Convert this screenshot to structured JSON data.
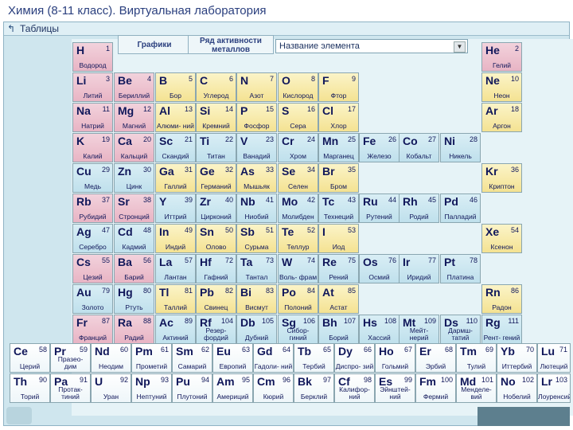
{
  "window": {
    "title": "Химия (8-11 класс). Виртуальная лаборатория"
  },
  "toolbar": {
    "icon": "back-arrow-icon",
    "label": "Таблицы"
  },
  "tabs": [
    {
      "label": "Графики"
    },
    {
      "label": "Ряд активности металлов"
    }
  ],
  "combo": {
    "value": "Название элемента"
  },
  "colors": {
    "s": "#e8b4c4",
    "p": "#f4e292",
    "d": "#bfe0ec",
    "f": "#ffffff"
  },
  "elements": [
    {
      "sym": "H",
      "num": "1",
      "name": "Водород",
      "t": "s",
      "r": 0,
      "c": 0
    },
    {
      "sym": "He",
      "num": "2",
      "name": "Гелий",
      "t": "s",
      "r": 0,
      "c": 10
    },
    {
      "sym": "Li",
      "num": "3",
      "name": "Литий",
      "t": "s",
      "r": 1,
      "c": 0
    },
    {
      "sym": "Be",
      "num": "4",
      "name": "Бериллий",
      "t": "s",
      "r": 1,
      "c": 1
    },
    {
      "sym": "B",
      "num": "5",
      "name": "Бор",
      "t": "p",
      "r": 1,
      "c": 2
    },
    {
      "sym": "C",
      "num": "6",
      "name": "Углерод",
      "t": "p",
      "r": 1,
      "c": 3
    },
    {
      "sym": "N",
      "num": "7",
      "name": "Азот",
      "t": "p",
      "r": 1,
      "c": 4
    },
    {
      "sym": "O",
      "num": "8",
      "name": "Кислород",
      "t": "p",
      "r": 1,
      "c": 5
    },
    {
      "sym": "F",
      "num": "9",
      "name": "Фтор",
      "t": "p",
      "r": 1,
      "c": 6
    },
    {
      "sym": "Ne",
      "num": "10",
      "name": "Неон",
      "t": "p",
      "r": 1,
      "c": 10
    },
    {
      "sym": "Na",
      "num": "11",
      "name": "Натрий",
      "t": "s",
      "r": 2,
      "c": 0
    },
    {
      "sym": "Mg",
      "num": "12",
      "name": "Магний",
      "t": "s",
      "r": 2,
      "c": 1
    },
    {
      "sym": "Al",
      "num": "13",
      "name": "Алюми- ний",
      "t": "p",
      "r": 2,
      "c": 2
    },
    {
      "sym": "Si",
      "num": "14",
      "name": "Кремний",
      "t": "p",
      "r": 2,
      "c": 3
    },
    {
      "sym": "P",
      "num": "15",
      "name": "Фосфор",
      "t": "p",
      "r": 2,
      "c": 4
    },
    {
      "sym": "S",
      "num": "16",
      "name": "Сера",
      "t": "p",
      "r": 2,
      "c": 5
    },
    {
      "sym": "Cl",
      "num": "17",
      "name": "Хлор",
      "t": "p",
      "r": 2,
      "c": 6
    },
    {
      "sym": "Ar",
      "num": "18",
      "name": "Аргон",
      "t": "p",
      "r": 2,
      "c": 10
    },
    {
      "sym": "K",
      "num": "19",
      "name": "Калий",
      "t": "s",
      "r": 3,
      "c": 0
    },
    {
      "sym": "Ca",
      "num": "20",
      "name": "Кальций",
      "t": "s",
      "r": 3,
      "c": 1
    },
    {
      "sym": "Sc",
      "num": "21",
      "name": "Скандий",
      "t": "d",
      "r": 3,
      "c": 2
    },
    {
      "sym": "Ti",
      "num": "22",
      "name": "Титан",
      "t": "d",
      "r": 3,
      "c": 3
    },
    {
      "sym": "V",
      "num": "23",
      "name": "Ванадий",
      "t": "d",
      "r": 3,
      "c": 4
    },
    {
      "sym": "Cr",
      "num": "24",
      "name": "Хром",
      "t": "d",
      "r": 3,
      "c": 5
    },
    {
      "sym": "Mn",
      "num": "25",
      "name": "Марганец",
      "t": "d",
      "r": 3,
      "c": 6
    },
    {
      "sym": "Fe",
      "num": "26",
      "name": "Железо",
      "t": "d",
      "r": 3,
      "c": 7
    },
    {
      "sym": "Co",
      "num": "27",
      "name": "Кобальт",
      "t": "d",
      "r": 3,
      "c": 8
    },
    {
      "sym": "Ni",
      "num": "28",
      "name": "Никель",
      "t": "d",
      "r": 3,
      "c": 9
    },
    {
      "sym": "Cu",
      "num": "29",
      "name": "Медь",
      "t": "d",
      "r": 4,
      "c": 0
    },
    {
      "sym": "Zn",
      "num": "30",
      "name": "Цинк",
      "t": "d",
      "r": 4,
      "c": 1
    },
    {
      "sym": "Ga",
      "num": "31",
      "name": "Галлий",
      "t": "p",
      "r": 4,
      "c": 2
    },
    {
      "sym": "Ge",
      "num": "32",
      "name": "Германий",
      "t": "p",
      "r": 4,
      "c": 3
    },
    {
      "sym": "As",
      "num": "33",
      "name": "Мышьяк",
      "t": "p",
      "r": 4,
      "c": 4
    },
    {
      "sym": "Se",
      "num": "34",
      "name": "Селен",
      "t": "p",
      "r": 4,
      "c": 5
    },
    {
      "sym": "Br",
      "num": "35",
      "name": "Бром",
      "t": "p",
      "r": 4,
      "c": 6
    },
    {
      "sym": "Kr",
      "num": "36",
      "name": "Криптон",
      "t": "p",
      "r": 4,
      "c": 10
    },
    {
      "sym": "Rb",
      "num": "37",
      "name": "Рубидий",
      "t": "s",
      "r": 5,
      "c": 0
    },
    {
      "sym": "Sr",
      "num": "38",
      "name": "Стронций",
      "t": "s",
      "r": 5,
      "c": 1
    },
    {
      "sym": "Y",
      "num": "39",
      "name": "Иттрий",
      "t": "d",
      "r": 5,
      "c": 2
    },
    {
      "sym": "Zr",
      "num": "40",
      "name": "Цирконий",
      "t": "d",
      "r": 5,
      "c": 3
    },
    {
      "sym": "Nb",
      "num": "41",
      "name": "Ниобий",
      "t": "d",
      "r": 5,
      "c": 4
    },
    {
      "sym": "Mo",
      "num": "42",
      "name": "Молибден",
      "t": "d",
      "r": 5,
      "c": 5
    },
    {
      "sym": "Tc",
      "num": "43",
      "name": "Технеций",
      "t": "d",
      "r": 5,
      "c": 6
    },
    {
      "sym": "Ru",
      "num": "44",
      "name": "Рутений",
      "t": "d",
      "r": 5,
      "c": 7
    },
    {
      "sym": "Rh",
      "num": "45",
      "name": "Родий",
      "t": "d",
      "r": 5,
      "c": 8
    },
    {
      "sym": "Pd",
      "num": "46",
      "name": "Палладий",
      "t": "d",
      "r": 5,
      "c": 9
    },
    {
      "sym": "Ag",
      "num": "47",
      "name": "Серебро",
      "t": "d",
      "r": 6,
      "c": 0
    },
    {
      "sym": "Cd",
      "num": "48",
      "name": "Кадмий",
      "t": "d",
      "r": 6,
      "c": 1
    },
    {
      "sym": "In",
      "num": "49",
      "name": "Индий",
      "t": "p",
      "r": 6,
      "c": 2
    },
    {
      "sym": "Sn",
      "num": "50",
      "name": "Олово",
      "t": "p",
      "r": 6,
      "c": 3
    },
    {
      "sym": "Sb",
      "num": "51",
      "name": "Сурьма",
      "t": "p",
      "r": 6,
      "c": 4
    },
    {
      "sym": "Te",
      "num": "52",
      "name": "Теллур",
      "t": "p",
      "r": 6,
      "c": 5
    },
    {
      "sym": "I",
      "num": "53",
      "name": "Иод",
      "t": "p",
      "r": 6,
      "c": 6
    },
    {
      "sym": "Xe",
      "num": "54",
      "name": "Ксенон",
      "t": "p",
      "r": 6,
      "c": 10
    },
    {
      "sym": "Cs",
      "num": "55",
      "name": "Цезий",
      "t": "s",
      "r": 7,
      "c": 0
    },
    {
      "sym": "Ba",
      "num": "56",
      "name": "Барий",
      "t": "s",
      "r": 7,
      "c": 1
    },
    {
      "sym": "La",
      "num": "57",
      "name": "Лантан",
      "t": "d",
      "r": 7,
      "c": 2
    },
    {
      "sym": "Hf",
      "num": "72",
      "name": "Гафний",
      "t": "d",
      "r": 7,
      "c": 3
    },
    {
      "sym": "Ta",
      "num": "73",
      "name": "Тантал",
      "t": "d",
      "r": 7,
      "c": 4
    },
    {
      "sym": "W",
      "num": "74",
      "name": "Воль- фрам",
      "t": "d",
      "r": 7,
      "c": 5
    },
    {
      "sym": "Re",
      "num": "75",
      "name": "Рений",
      "t": "d",
      "r": 7,
      "c": 6
    },
    {
      "sym": "Os",
      "num": "76",
      "name": "Осмий",
      "t": "d",
      "r": 7,
      "c": 7
    },
    {
      "sym": "Ir",
      "num": "77",
      "name": "Иридий",
      "t": "d",
      "r": 7,
      "c": 8
    },
    {
      "sym": "Pt",
      "num": "78",
      "name": "Платина",
      "t": "d",
      "r": 7,
      "c": 9
    },
    {
      "sym": "Au",
      "num": "79",
      "name": "Золото",
      "t": "d",
      "r": 8,
      "c": 0
    },
    {
      "sym": "Hg",
      "num": "80",
      "name": "Ртуть",
      "t": "d",
      "r": 8,
      "c": 1
    },
    {
      "sym": "Tl",
      "num": "81",
      "name": "Таллий",
      "t": "p",
      "r": 8,
      "c": 2
    },
    {
      "sym": "Pb",
      "num": "82",
      "name": "Свинец",
      "t": "p",
      "r": 8,
      "c": 3
    },
    {
      "sym": "Bi",
      "num": "83",
      "name": "Висмут",
      "t": "p",
      "r": 8,
      "c": 4
    },
    {
      "sym": "Po",
      "num": "84",
      "name": "Полоний",
      "t": "p",
      "r": 8,
      "c": 5
    },
    {
      "sym": "At",
      "num": "85",
      "name": "Астат",
      "t": "p",
      "r": 8,
      "c": 6
    },
    {
      "sym": "Rn",
      "num": "86",
      "name": "Радон",
      "t": "p",
      "r": 8,
      "c": 10
    },
    {
      "sym": "Fr",
      "num": "87",
      "name": "Франций",
      "t": "s",
      "r": 9,
      "c": 0
    },
    {
      "sym": "Ra",
      "num": "88",
      "name": "Радий",
      "t": "s",
      "r": 9,
      "c": 1
    },
    {
      "sym": "Ac",
      "num": "89",
      "name": "Актиний",
      "t": "d",
      "r": 9,
      "c": 2
    },
    {
      "sym": "Rf",
      "num": "104",
      "name": "Резер- фордий",
      "t": "d",
      "r": 9,
      "c": 3
    },
    {
      "sym": "Db",
      "num": "105",
      "name": "Дубний",
      "t": "d",
      "r": 9,
      "c": 4
    },
    {
      "sym": "Sg",
      "num": "106",
      "name": "Сибор- гиний",
      "t": "d",
      "r": 9,
      "c": 5
    },
    {
      "sym": "Bh",
      "num": "107",
      "name": "Борий",
      "t": "d",
      "r": 9,
      "c": 6
    },
    {
      "sym": "Hs",
      "num": "108",
      "name": "Хассий",
      "t": "d",
      "r": 9,
      "c": 7
    },
    {
      "sym": "Mt",
      "num": "109",
      "name": "Мейт- нерий",
      "t": "d",
      "r": 9,
      "c": 8
    },
    {
      "sym": "Ds",
      "num": "110",
      "name": "Дармш- татий",
      "t": "d",
      "r": 9,
      "c": 9
    },
    {
      "sym": "Rg",
      "num": "111",
      "name": "Рент- гений",
      "t": "d",
      "r": 9,
      "c": 10
    }
  ],
  "fblock": [
    {
      "sym": "Ce",
      "num": "58",
      "name": "Церий",
      "r": 0,
      "c": 0
    },
    {
      "sym": "Pr",
      "num": "59",
      "name": "Празео- дим",
      "r": 0,
      "c": 1
    },
    {
      "sym": "Nd",
      "num": "60",
      "name": "Неодим",
      "r": 0,
      "c": 2
    },
    {
      "sym": "Pm",
      "num": "61",
      "name": "Прометий",
      "r": 0,
      "c": 3
    },
    {
      "sym": "Sm",
      "num": "62",
      "name": "Самарий",
      "r": 0,
      "c": 4
    },
    {
      "sym": "Eu",
      "num": "63",
      "name": "Европий",
      "r": 0,
      "c": 5
    },
    {
      "sym": "Gd",
      "num": "64",
      "name": "Гадоли- ний",
      "r": 0,
      "c": 6
    },
    {
      "sym": "Tb",
      "num": "65",
      "name": "Тербий",
      "r": 0,
      "c": 7
    },
    {
      "sym": "Dy",
      "num": "66",
      "name": "Диспро- зий",
      "r": 0,
      "c": 8
    },
    {
      "sym": "Ho",
      "num": "67",
      "name": "Гольмий",
      "r": 0,
      "c": 9
    },
    {
      "sym": "Er",
      "num": "68",
      "name": "Эрбий",
      "r": 0,
      "c": 10
    },
    {
      "sym": "Tm",
      "num": "69",
      "name": "Тулий",
      "r": 0,
      "c": 11
    },
    {
      "sym": "Yb",
      "num": "70",
      "name": "Иттербий",
      "r": 0,
      "c": 12
    },
    {
      "sym": "Lu",
      "num": "71",
      "name": "Лютеций",
      "r": 0,
      "c": 13
    },
    {
      "sym": "Th",
      "num": "90",
      "name": "Торий",
      "r": 1,
      "c": 0
    },
    {
      "sym": "Pa",
      "num": "91",
      "name": "Протак- тиний",
      "r": 1,
      "c": 1
    },
    {
      "sym": "U",
      "num": "92",
      "name": "Уран",
      "r": 1,
      "c": 2
    },
    {
      "sym": "Np",
      "num": "93",
      "name": "Нептуний",
      "r": 1,
      "c": 3
    },
    {
      "sym": "Pu",
      "num": "94",
      "name": "Плутоний",
      "r": 1,
      "c": 4
    },
    {
      "sym": "Am",
      "num": "95",
      "name": "Америций",
      "r": 1,
      "c": 5
    },
    {
      "sym": "Cm",
      "num": "96",
      "name": "Кюрий",
      "r": 1,
      "c": 6
    },
    {
      "sym": "Bk",
      "num": "97",
      "name": "Берклий",
      "r": 1,
      "c": 7
    },
    {
      "sym": "Cf",
      "num": "98",
      "name": "Калифор- ний",
      "r": 1,
      "c": 8
    },
    {
      "sym": "Es",
      "num": "99",
      "name": "Эйнштей- ний",
      "r": 1,
      "c": 9
    },
    {
      "sym": "Fm",
      "num": "100",
      "name": "Фермий",
      "r": 1,
      "c": 10
    },
    {
      "sym": "Md",
      "num": "101",
      "name": "Менделе- вий",
      "r": 1,
      "c": 11
    },
    {
      "sym": "No",
      "num": "102",
      "name": "Нобелий",
      "r": 1,
      "c": 12
    },
    {
      "sym": "Lr",
      "num": "103",
      "name": "Лоуренсий",
      "r": 1,
      "c": 13
    }
  ]
}
